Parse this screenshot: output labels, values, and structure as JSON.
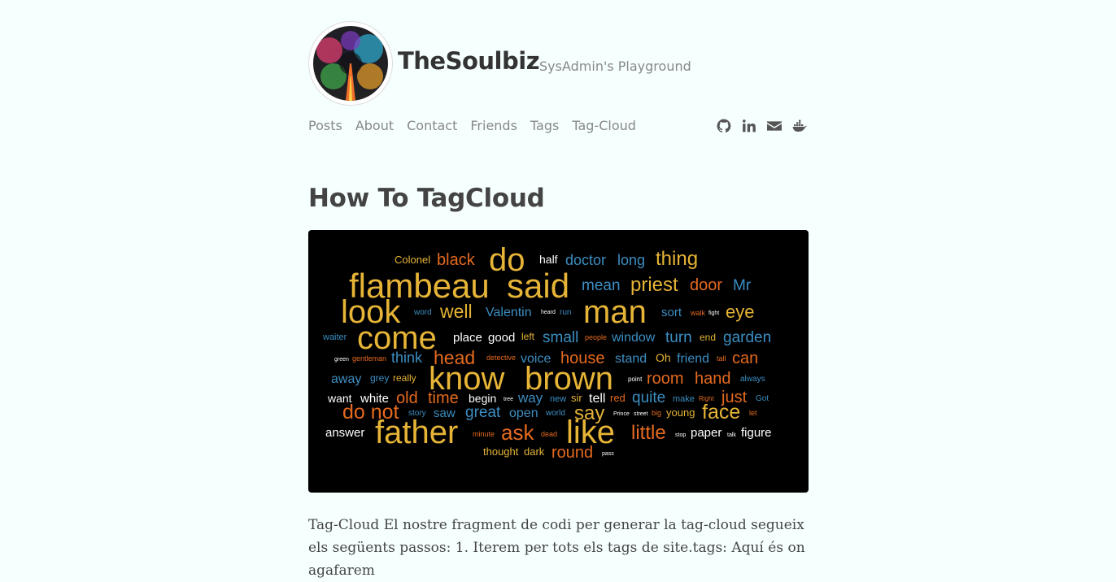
{
  "site": {
    "title": "TheSoulbiz",
    "tagline": "SysAdmin's Playground"
  },
  "nav": [
    {
      "label": "Posts"
    },
    {
      "label": "About"
    },
    {
      "label": "Contact"
    },
    {
      "label": "Friends"
    },
    {
      "label": "Tags"
    },
    {
      "label": "Tag-Cloud"
    }
  ],
  "social": [
    "github-icon",
    "linkedin-icon",
    "envelope-icon",
    "docker-icon"
  ],
  "post": {
    "title": "How To TagCloud",
    "body": "Tag-Cloud El nostre fragment de codi per generar la tag-cloud segueix els següents passos: 1. Iterem per tots els tags de site.tags: Aquí és on agafarem"
  },
  "colors": {
    "background": "#f5fffe",
    "cloud_background": "#000000",
    "yellow": "#e6b436",
    "orange": "#e56a1e",
    "blue": "#3b8ec2",
    "white": "#ffffff"
  },
  "word_cloud": [
    {
      "text": "Colonel",
      "c": "yellow"
    },
    {
      "text": "black",
      "c": "orange"
    },
    {
      "text": "do",
      "c": "yellow"
    },
    {
      "text": "half",
      "c": "white"
    },
    {
      "text": "doctor",
      "c": "blue"
    },
    {
      "text": "long",
      "c": "blue"
    },
    {
      "text": "thing",
      "c": "yellow"
    },
    {
      "text": "flambeau",
      "c": "yellow"
    },
    {
      "text": "said",
      "c": "yellow"
    },
    {
      "text": "mean",
      "c": "blue"
    },
    {
      "text": "priest",
      "c": "yellow"
    },
    {
      "text": "door",
      "c": "orange"
    },
    {
      "text": "Mr",
      "c": "blue"
    },
    {
      "text": "look",
      "c": "yellow"
    },
    {
      "text": "word",
      "c": "blue"
    },
    {
      "text": "well",
      "c": "yellow"
    },
    {
      "text": "Valentin",
      "c": "blue"
    },
    {
      "text": "heard",
      "c": "white"
    },
    {
      "text": "run",
      "c": "blue"
    },
    {
      "text": "man",
      "c": "yellow"
    },
    {
      "text": "sort",
      "c": "blue"
    },
    {
      "text": "walk",
      "c": "orange"
    },
    {
      "text": "fight",
      "c": "white"
    },
    {
      "text": "eye",
      "c": "yellow"
    },
    {
      "text": "waiter",
      "c": "blue"
    },
    {
      "text": "come",
      "c": "yellow"
    },
    {
      "text": "place",
      "c": "white"
    },
    {
      "text": "good",
      "c": "white"
    },
    {
      "text": "left",
      "c": "yellow"
    },
    {
      "text": "small",
      "c": "blue"
    },
    {
      "text": "people",
      "c": "orange"
    },
    {
      "text": "window",
      "c": "blue"
    },
    {
      "text": "turn",
      "c": "blue"
    },
    {
      "text": "end",
      "c": "yellow"
    },
    {
      "text": "garden",
      "c": "blue"
    },
    {
      "text": "green",
      "c": "white"
    },
    {
      "text": "gentleman",
      "c": "orange"
    },
    {
      "text": "think",
      "c": "blue"
    },
    {
      "text": "head",
      "c": "orange"
    },
    {
      "text": "detective",
      "c": "orange"
    },
    {
      "text": "voice",
      "c": "blue"
    },
    {
      "text": "house",
      "c": "orange"
    },
    {
      "text": "stand",
      "c": "blue"
    },
    {
      "text": "Oh",
      "c": "yellow"
    },
    {
      "text": "friend",
      "c": "blue"
    },
    {
      "text": "tall",
      "c": "orange"
    },
    {
      "text": "can",
      "c": "orange"
    },
    {
      "text": "away",
      "c": "blue"
    },
    {
      "text": "grey",
      "c": "blue"
    },
    {
      "text": "really",
      "c": "yellow"
    },
    {
      "text": "know",
      "c": "yellow"
    },
    {
      "text": "brown",
      "c": "yellow"
    },
    {
      "text": "point",
      "c": "white"
    },
    {
      "text": "room",
      "c": "orange"
    },
    {
      "text": "hand",
      "c": "orange"
    },
    {
      "text": "always",
      "c": "blue"
    },
    {
      "text": "want",
      "c": "white"
    },
    {
      "text": "white",
      "c": "white"
    },
    {
      "text": "old",
      "c": "orange"
    },
    {
      "text": "time",
      "c": "orange"
    },
    {
      "text": "begin",
      "c": "white"
    },
    {
      "text": "tree",
      "c": "white"
    },
    {
      "text": "way",
      "c": "blue"
    },
    {
      "text": "new",
      "c": "blue"
    },
    {
      "text": "sir",
      "c": "yellow"
    },
    {
      "text": "tell",
      "c": "white"
    },
    {
      "text": "red",
      "c": "orange"
    },
    {
      "text": "quite",
      "c": "blue"
    },
    {
      "text": "make",
      "c": "blue"
    },
    {
      "text": "Right",
      "c": "orange"
    },
    {
      "text": "just",
      "c": "orange"
    },
    {
      "text": "Got",
      "c": "blue"
    },
    {
      "text": "do not",
      "c": "orange"
    },
    {
      "text": "story",
      "c": "blue"
    },
    {
      "text": "saw",
      "c": "blue"
    },
    {
      "text": "great",
      "c": "blue"
    },
    {
      "text": "open",
      "c": "blue"
    },
    {
      "text": "world",
      "c": "blue"
    },
    {
      "text": "say",
      "c": "yellow"
    },
    {
      "text": "Prince",
      "c": "white"
    },
    {
      "text": "street",
      "c": "white"
    },
    {
      "text": "big",
      "c": "orange"
    },
    {
      "text": "young",
      "c": "yellow"
    },
    {
      "text": "face",
      "c": "yellow"
    },
    {
      "text": "let",
      "c": "orange"
    },
    {
      "text": "answer",
      "c": "white"
    },
    {
      "text": "father",
      "c": "yellow"
    },
    {
      "text": "minute",
      "c": "orange"
    },
    {
      "text": "ask",
      "c": "orange"
    },
    {
      "text": "dead",
      "c": "orange"
    },
    {
      "text": "like",
      "c": "yellow"
    },
    {
      "text": "little",
      "c": "orange"
    },
    {
      "text": "stop",
      "c": "white"
    },
    {
      "text": "paper",
      "c": "white"
    },
    {
      "text": "talk",
      "c": "white"
    },
    {
      "text": "figure",
      "c": "white"
    },
    {
      "text": "thought",
      "c": "yellow"
    },
    {
      "text": "dark",
      "c": "yellow"
    },
    {
      "text": "round",
      "c": "orange"
    },
    {
      "text": "pass",
      "c": "white"
    }
  ]
}
